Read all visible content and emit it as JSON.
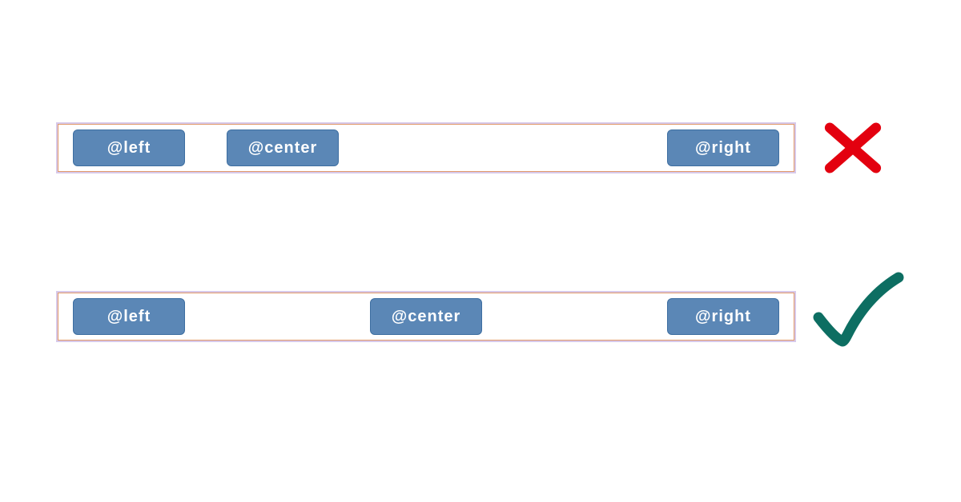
{
  "examples": {
    "incorrect": {
      "buttons": {
        "left": {
          "label": "@left"
        },
        "center": {
          "label": "@center"
        },
        "right": {
          "label": "@right"
        }
      },
      "marker": "cross"
    },
    "correct": {
      "buttons": {
        "left": {
          "label": "@left"
        },
        "center": {
          "label": "@center"
        },
        "right": {
          "label": "@right"
        }
      },
      "marker": "check"
    }
  },
  "colors": {
    "button_bg": "#5b87b6",
    "button_border": "#3d6ea1",
    "frame_border": "#e29a6a",
    "frame_outline": "#d7c9ea",
    "cross": "#e3000f",
    "check": "#0d6e62"
  }
}
